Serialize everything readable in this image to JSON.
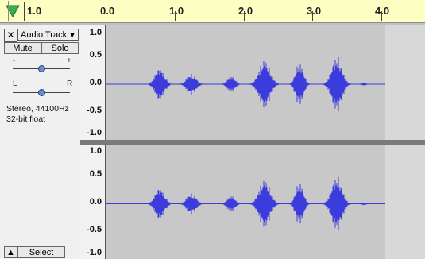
{
  "ruler": {
    "labels": [
      "1.0",
      "0.0",
      "1.0",
      "2.0",
      "3.0",
      "4.0"
    ]
  },
  "track": {
    "close": "✕",
    "name": "Audio Track",
    "mute": "Mute",
    "solo": "Solo",
    "gain_minus": "-",
    "gain_plus": "+",
    "pan_left": "L",
    "pan_right": "R",
    "format_line1": "Stereo, 44100Hz",
    "format_line2": "32-bit float",
    "collapse": "▲",
    "select": "Select"
  },
  "vertical_ruler": {
    "ticks": [
      "1.0",
      "0.5",
      "0.0",
      "-0.5",
      "-1.0"
    ]
  },
  "colors": {
    "waveform": "#3c3cdc",
    "ruler_background": "#fdfec2",
    "play_indicator": "#3aa93a"
  }
}
